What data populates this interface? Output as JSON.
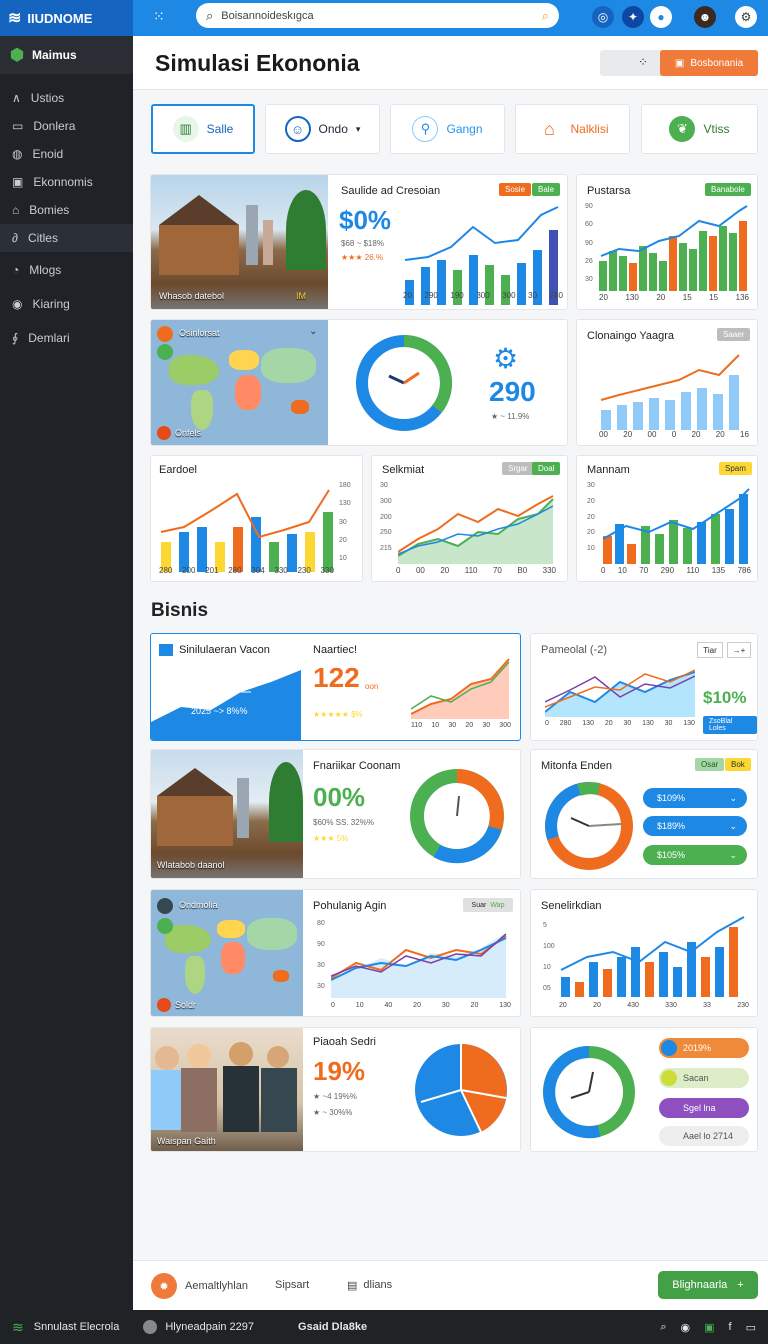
{
  "topbar": {
    "brand": "IIUDNOME",
    "search_value": "Boisannoideskıgca"
  },
  "sidebar": {
    "top_label": "Maimus",
    "items": [
      {
        "label": "Ustios",
        "icon": "chevron-icon"
      },
      {
        "label": "Donlera",
        "icon": "folder-icon"
      },
      {
        "label": "Enoid",
        "icon": "globe-icon"
      },
      {
        "label": "Ekonnomis",
        "icon": "chart-icon"
      },
      {
        "label": "Bomies",
        "icon": "building-icon"
      },
      {
        "label": "Citles",
        "icon": "link-icon"
      },
      {
        "label": "Mlogs",
        "icon": "clock-icon"
      },
      {
        "label": "Kiaring",
        "icon": "target-icon"
      },
      {
        "label": "Demlari",
        "icon": "pen-icon"
      }
    ]
  },
  "header": {
    "title": "Simulasi Ekononia",
    "action_label": "Bosbonania"
  },
  "tabs": [
    {
      "label": "Salle",
      "icon": "chart-icon"
    },
    {
      "label": "Ondo",
      "icon": "user-icon"
    },
    {
      "label": "Gangn",
      "icon": "bike-icon"
    },
    {
      "label": "Nalklisi",
      "icon": "house-icon"
    },
    {
      "label": "Vtiss",
      "icon": "leaf-icon"
    }
  ],
  "cards": {
    "c1": {
      "title": "Saulide ad Cresoian",
      "pill_a": "Sosie",
      "pill_b": "Bale",
      "big": "$0%",
      "sub1": "$68 ~ $18%",
      "sub2": "★★★ 26.%",
      "img_label": "Whasob datebol",
      "img_tag": "IM",
      "xticks": [
        "20",
        "290",
        "190",
        "300",
        "300",
        "30",
        "280"
      ]
    },
    "c2": {
      "title": "Pustarsa",
      "pill": "Banabole",
      "xticks": [
        "20",
        "130",
        "20",
        "15",
        "15",
        "136"
      ],
      "yticks": [
        "90",
        "60",
        "90",
        "26",
        "30"
      ]
    },
    "c3": {
      "title": "Osinlorsat",
      "label": "Onfels"
    },
    "c4": {
      "big": "290",
      "sub": "★ ~ 11.9%"
    },
    "c5": {
      "title": "Clonaingo Yaagra",
      "pill": "Saaer",
      "xticks": [
        "00",
        "20",
        "00",
        "0",
        "20",
        "20",
        "16"
      ]
    },
    "c6": {
      "title": "Eardoel",
      "xticks": [
        "280",
        "200",
        "201",
        "280",
        "304",
        "330",
        "230",
        "330"
      ],
      "yticks": [
        "180",
        "130",
        "30",
        "20",
        "10"
      ]
    },
    "c7": {
      "title": "Selkmiat",
      "pill_a": "Srgar",
      "pill_b": "Doal",
      "xticks": [
        "0",
        "00",
        "20",
        "110",
        "70",
        "B0",
        "330"
      ],
      "yticks": [
        "30",
        "300",
        "200",
        "250",
        "215"
      ]
    },
    "c8": {
      "title": "Mannam",
      "pill": "Spam",
      "xticks": [
        "0",
        "10",
        "70",
        "290",
        "110",
        "135",
        "786"
      ],
      "yticks": [
        "30",
        "20",
        "20",
        "20",
        "10"
      ]
    }
  },
  "section_title": "Bisnis",
  "biz": {
    "b1": {
      "title": "Sinilulaeran Vacon",
      "range": "2025 ~> 8%%"
    },
    "b2": {
      "title": "Naartiec!",
      "big": "122",
      "unit": "oon",
      "stars": "★★★★★ $%",
      "xticks": [
        "110",
        "10",
        "30",
        "20",
        "30",
        "300"
      ]
    },
    "b3": {
      "title": "Pameolal (-2)",
      "btn": "Tiar",
      "btn2": "→+",
      "big": "$10%",
      "tag": "ZsoBlal Loles",
      "xticks": [
        "0",
        "280",
        "130",
        "20",
        "30",
        "130",
        "30",
        "130"
      ]
    },
    "b4": {
      "title": "Fnariikar Coonam",
      "big": "00%",
      "sub": "$60% SS. 32%%",
      "stars": "★★★ 5%",
      "img_label": "Wlatabob daanol"
    },
    "b5": {
      "title": "Mitonfa Enden",
      "pill_a": "Osar",
      "pill_b": "Bok",
      "rows": [
        "$109%",
        "$189%",
        "$105%"
      ]
    },
    "b6": {
      "title": "Ondmolia",
      "label": "Soldr"
    },
    "b7": {
      "title": "Pohulanig Agin",
      "pill": "Suar",
      "pill2": "Wap",
      "xticks": [
        "0",
        "10",
        "40",
        "20",
        "30",
        "20",
        "130"
      ],
      "yticks": [
        "80",
        "90",
        "30",
        "30"
      ]
    },
    "b8": {
      "title": "Senelirkdian",
      "xticks": [
        "20",
        "20",
        "430",
        "330",
        "33",
        "230"
      ],
      "yticks": [
        "5",
        "100",
        "10",
        "05"
      ]
    },
    "b9": {
      "title": "Piaoah Sedri",
      "big": "19%",
      "sub1": "★ ~4 19%%",
      "sub2": "★ ~ 30%%",
      "img_label": "Waispan Gaith"
    },
    "b10": {
      "rows": [
        "2019%",
        "Sacan",
        "Sgel lna",
        "Aael lo 2714"
      ]
    }
  },
  "bottom": {
    "item1": "Aemaltlyhlan",
    "item2": "Sipsart",
    "item3": "dlians",
    "cta": "Blighnaarla"
  },
  "taskbar": {
    "app": "Snnulast Elecrola",
    "status": "Hlyneadpain 2297",
    "badge": "Gsaid Dla8ke"
  },
  "colors": {
    "blue": "#1e88e5",
    "orange": "#ef6c1f",
    "green": "#4caf50",
    "yellow": "#fdd835",
    "purple": "#7b3fa8"
  }
}
